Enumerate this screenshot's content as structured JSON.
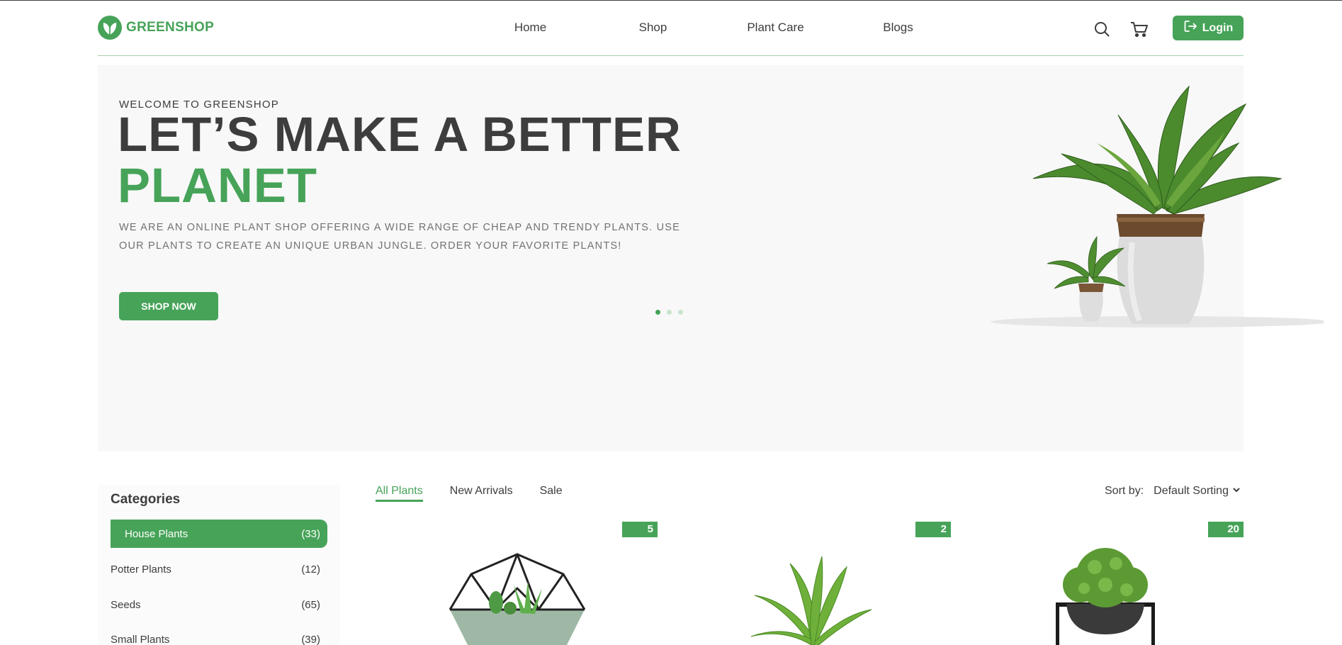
{
  "header": {
    "logo_text": "GREENSHOP",
    "nav": [
      "Home",
      "Shop",
      "Plant Care",
      "Blogs"
    ],
    "login_label": "Login"
  },
  "hero": {
    "welcome": "WELCOME TO GREENSHOP",
    "headline_line1": "LET’S MAKE A BETTER",
    "headline_line2": "PLANET",
    "description": "WE ARE AN ONLINE PLANT SHOP OFFERING A WIDE RANGE OF CHEAP AND TRENDY PLANTS. USE OUR PLANTS TO CREATE AN UNIQUE URBAN JUNGLE. ORDER YOUR FAVORITE PLANTS!",
    "cta_label": "SHOP NOW",
    "slide_count": 3,
    "active_slide": 1
  },
  "categories": {
    "title": "Categories",
    "items": [
      {
        "name": "House Plants",
        "count": "(33)",
        "active": true
      },
      {
        "name": "Potter Plants",
        "count": "(12)",
        "active": false
      },
      {
        "name": "Seeds",
        "count": "(65)",
        "active": false
      },
      {
        "name": "Small Plants",
        "count": "(39)",
        "active": false
      }
    ]
  },
  "products": {
    "tabs": [
      "All Plants",
      "New Arrivals",
      "Sale"
    ],
    "active_tab": "All Plants",
    "sort_label": "Sort by:",
    "sort_value": "Default Sorting",
    "badges": [
      "5",
      "2",
      "20"
    ]
  },
  "colors": {
    "brand": "#46a358",
    "text": "#3d3d3d",
    "hero_bg": "#f8f8f8"
  },
  "icons": [
    "leaf-logo-icon",
    "search-icon",
    "cart-icon",
    "logout-icon",
    "chevron-down-icon"
  ]
}
